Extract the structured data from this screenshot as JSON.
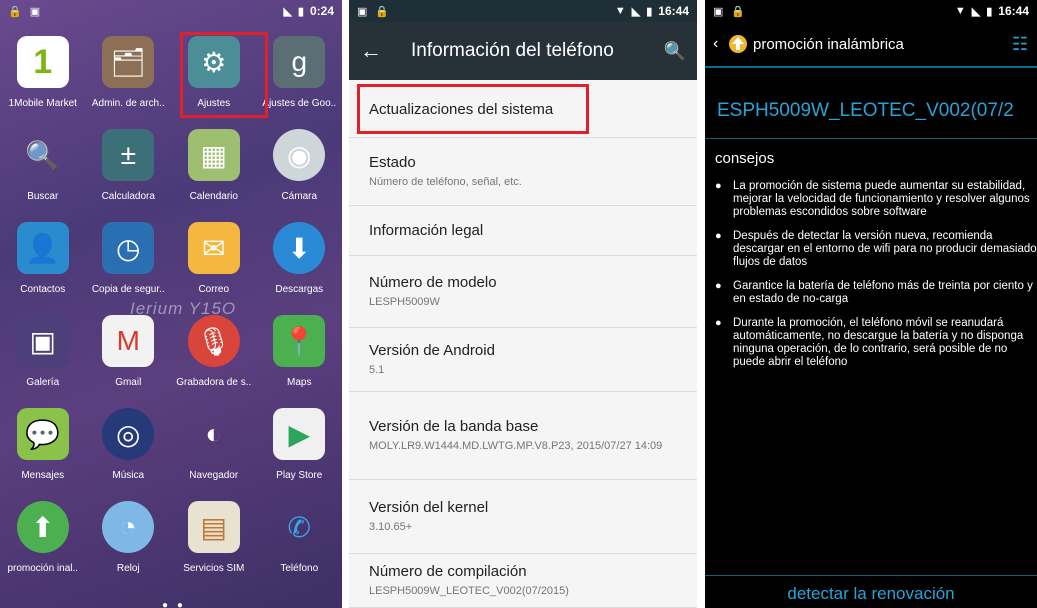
{
  "colors": {
    "highlight": "#e0202a",
    "settings_toolbar": "#263238",
    "update_accent": "#29a3d6"
  },
  "panel1": {
    "status": {
      "time": "0:24"
    },
    "apps": [
      {
        "label": "1Mobile Market",
        "icon": "1mobile-icon",
        "glyph": "1"
      },
      {
        "label": "Admin. de arch..",
        "icon": "file-manager-icon",
        "glyph": "🗂"
      },
      {
        "label": "Ajustes",
        "icon": "settings-icon",
        "glyph": "⚙"
      },
      {
        "label": "Ajustes de Goo..",
        "icon": "google-settings-icon",
        "glyph": "g"
      },
      {
        "label": "Buscar",
        "icon": "magnifier-icon",
        "glyph": "🔍"
      },
      {
        "label": "Calculadora",
        "icon": "calculator-icon",
        "glyph": "±"
      },
      {
        "label": "Calendario",
        "icon": "calendar-icon",
        "glyph": "▦"
      },
      {
        "label": "Cámara",
        "icon": "camera-icon",
        "glyph": "◉"
      },
      {
        "label": "Contactos",
        "icon": "contacts-icon",
        "glyph": "👤"
      },
      {
        "label": "Copia de segur..",
        "icon": "backup-icon",
        "glyph": "◷"
      },
      {
        "label": "Correo",
        "icon": "mail-icon",
        "glyph": "✉"
      },
      {
        "label": "Descargas",
        "icon": "download-icon",
        "glyph": "⬇"
      },
      {
        "label": "Galería",
        "icon": "gallery-icon",
        "glyph": "▣"
      },
      {
        "label": "Gmail",
        "icon": "gmail-icon",
        "glyph": "M"
      },
      {
        "label": "Grabadora de s..",
        "icon": "recorder-icon",
        "glyph": "🎙"
      },
      {
        "label": "Maps",
        "icon": "maps-icon",
        "glyph": "📍"
      },
      {
        "label": "Mensajes",
        "icon": "messages-icon",
        "glyph": "💬"
      },
      {
        "label": "Música",
        "icon": "music-icon",
        "glyph": "◎"
      },
      {
        "label": "Navegador",
        "icon": "browser-icon",
        "glyph": "◐"
      },
      {
        "label": "Play Store",
        "icon": "play-store-icon",
        "glyph": "▶"
      },
      {
        "label": "promoción inal..",
        "icon": "wireless-update-icon",
        "glyph": "⬆"
      },
      {
        "label": "Reloj",
        "icon": "clock-icon",
        "glyph": "◔"
      },
      {
        "label": "Servicios SIM",
        "icon": "sim-icon",
        "glyph": "▤"
      },
      {
        "label": "Teléfono",
        "icon": "phone-icon",
        "glyph": "✆"
      }
    ],
    "watermark": "Ierium Y15O"
  },
  "panel2": {
    "status": {
      "time": "16:44"
    },
    "title": "Información del teléfono",
    "rows": [
      {
        "title": "Actualizaciones del sistema",
        "sub": ""
      },
      {
        "title": "Estado",
        "sub": "Número de teléfono, señal, etc."
      },
      {
        "title": "Información legal",
        "sub": ""
      },
      {
        "title": "Número de modelo",
        "sub": "LESPH5009W"
      },
      {
        "title": "Versión de Android",
        "sub": "5.1"
      },
      {
        "title": "Versión de la banda base",
        "sub": "MOLY.LR9.W1444.MD.LWTG.MP.V8.P23, 2015/07/27 14:09"
      },
      {
        "title": "Versión del kernel",
        "sub": "3.10.65+"
      },
      {
        "title": "Número de compilación",
        "sub": "LESPH5009W_LEOTEC_V002(07/2015)"
      }
    ]
  },
  "panel3": {
    "status": {
      "time": "16:44"
    },
    "title": "promoción inalámbrica",
    "version": "ESPH5009W_LEOTEC_V002(07/2",
    "tips_heading": "consejos",
    "tips": [
      "La promoción de sistema puede aumentar su estabilidad, mejorar la velocidad de funcionamiento y resolver algunos problemas escondidos sobre software",
      "Después de detectar la versión nueva, recomienda descargar en el entorno de wifi para no producir demasiado flujos de datos",
      "Garantice la batería de teléfono más de treinta por ciento y en estado de no-carga",
      "Durante la promoción, el teléfono móvil se reanudará automáticamente, no descargue la batería y no disponga ninguna operación, de lo contrario, será posible de no puede abrir el teléfono"
    ],
    "action": "detectar la renovación"
  }
}
